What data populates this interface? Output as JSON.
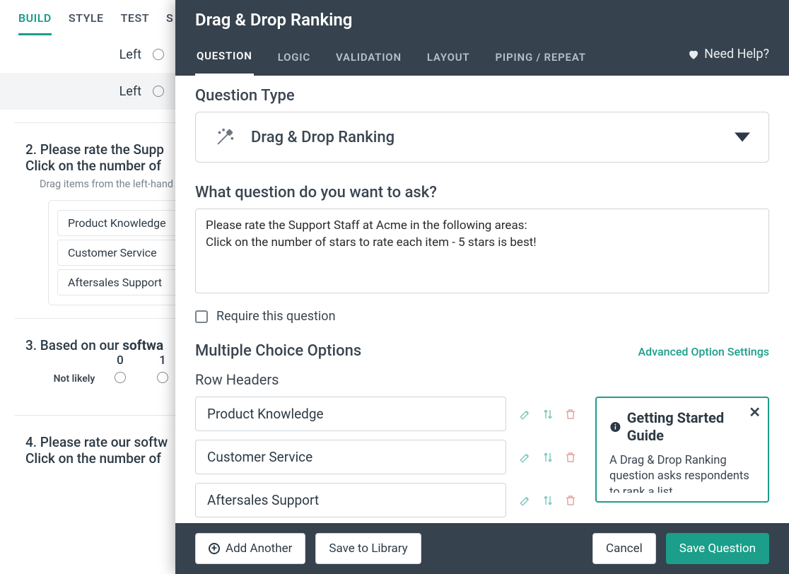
{
  "bg": {
    "tabs": [
      "BUILD",
      "STYLE",
      "TEST",
      "S"
    ],
    "active_tab": 0,
    "row1": "Left",
    "row2": "Left",
    "q2_title": "2. Please rate the Supp",
    "q2_sub": "Click on the number of",
    "q2_hint": "Drag items from the left-hand",
    "q2_items": [
      "Product Knowledge",
      "Customer Service",
      "Aftersales Support"
    ],
    "q3_title_a": "3. Based on our ",
    "q3_title_b": "softwa",
    "q3_hdrs": [
      "0",
      "1"
    ],
    "q3_label": "Not likely",
    "q4_title": "4. Please rate our softw",
    "q4_sub": "Click on the number of"
  },
  "modal": {
    "title": "Drag & Drop Ranking",
    "tabs": [
      "QUESTION",
      "LOGIC",
      "VALIDATION",
      "LAYOUT",
      "PIPING / REPEAT"
    ],
    "active_tab": 0,
    "help": "Need Help?",
    "qtype_label": "Question Type",
    "qtype_value": "Drag & Drop Ranking",
    "ask_label": "What question do you want to ask?",
    "ask_value": "Please rate the Support Staff at Acme in the following areas:\nClick on the number of stars to rate each item - 5 stars is best!",
    "require_label": "Require this question",
    "mc_label": "Multiple Choice Options",
    "adv_link": "Advanced Option Settings",
    "row_headers_label": "Row Headers",
    "rows": [
      "Product Knowledge",
      "Customer Service",
      "Aftersales Support"
    ],
    "gs_title": "Getting Started Guide",
    "gs_body": "A Drag & Drop Ranking question asks respondents to rank a list",
    "footer": {
      "add": "Add Another",
      "save_lib": "Save to Library",
      "cancel": "Cancel",
      "save": "Save Question"
    }
  }
}
